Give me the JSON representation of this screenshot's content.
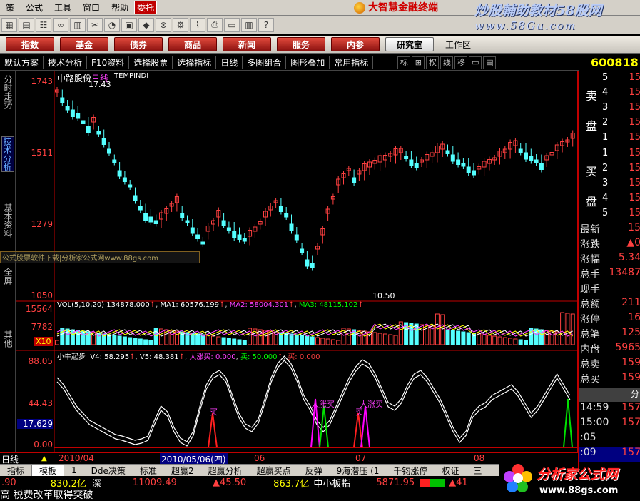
{
  "menu": {
    "items": [
      "策",
      "公式",
      "工具",
      "窗口",
      "帮助"
    ],
    "special": "委托",
    "banner": "大智慧金融终端"
  },
  "watermark_top": {
    "line1": "炒股輔助教材58股网",
    "line2": "www.58Gu.com"
  },
  "quickbar": {
    "buttons": [
      "指数",
      "基金",
      "债券",
      "商品",
      "新闻",
      "服务",
      "内参"
    ],
    "active": "研究室",
    "right": "工作区"
  },
  "funcbar": {
    "items": [
      "默认方案",
      "技术分析",
      "F10资料",
      "选择股票",
      "选择指标",
      "日线",
      "多图组合",
      "图形叠加",
      "常用指标"
    ],
    "toggles": [
      "标",
      "权",
      "线",
      "移"
    ],
    "stock_code": "600818"
  },
  "lefttabs": [
    "分时走势",
    "技术分析",
    "基本资料",
    "全屏",
    "其他"
  ],
  "kline": {
    "title_name": "中路股份",
    "title_period": "日线",
    "title_indicator": "TEMPINDI",
    "high_label": "17.43",
    "low_label": "10.50",
    "y_ticks": [
      "1743",
      "1511",
      "1279",
      "1050"
    ],
    "watermark": "公式股票软件下载|分析家公式网www.88gs.com"
  },
  "volume": {
    "header": "VOL(5,10,20)",
    "vol": "134878.000",
    "ma1_label": "MA1:",
    "ma1": "60576.199",
    "ma2_label": "MA2:",
    "ma2": "58004.301",
    "ma3_label": "MA3:",
    "ma3": "48115.102",
    "y_ticks": [
      "15564",
      "7782"
    ],
    "unit": "X10"
  },
  "indicator": {
    "name": "小牛起步",
    "v4_label": "V4:",
    "v4": "58.295",
    "v5_label": "V5:",
    "v5": "48.381",
    "big_buy_label": "大涨买:",
    "big_buy": "0.000",
    "sell_label": "卖:",
    "sell": "50.000",
    "buy_label": "买:",
    "buy": "0.000",
    "y_ticks": [
      "88.05",
      "44.43",
      "17.629",
      "0.00"
    ],
    "signals": [
      "买",
      "大涨买",
      "买",
      "大涨买"
    ]
  },
  "datebar": {
    "period": "日线",
    "months": [
      "2010/04",
      "06",
      "07",
      "08"
    ],
    "cursor_date": "2010/05/06",
    "cursor_day": "(四)"
  },
  "rightpanel": {
    "sell_label": [
      "卖",
      "盘"
    ],
    "buy_label": [
      "买",
      "盘"
    ],
    "sell_levels": [
      "5",
      "4",
      "3",
      "2",
      "1"
    ],
    "buy_levels": [
      "1",
      "2",
      "3",
      "4",
      "5"
    ],
    "sell_prices": [
      "15",
      "15",
      "15",
      "15",
      "15"
    ],
    "buy_prices": [
      "15",
      "15",
      "15",
      "15",
      "15"
    ],
    "stats": [
      {
        "k": "最新",
        "v": "15"
      },
      {
        "k": "涨跌",
        "v": "▲0"
      },
      {
        "k": "涨幅",
        "v": "5.34"
      },
      {
        "k": "总手",
        "v": "13487"
      },
      {
        "k": "现手",
        "v": ""
      },
      {
        "k": "总额",
        "v": "211"
      },
      {
        "k": "涨停",
        "v": "16"
      },
      {
        "k": "总笔",
        "v": "125"
      },
      {
        "k": "内盘",
        "v": "5965"
      },
      {
        "k": "总卖",
        "v": "159"
      },
      {
        "k": "总买",
        "v": "159"
      }
    ],
    "fen": "分",
    "ticks": [
      {
        "t": "14:59",
        "p": "157"
      },
      {
        "t": "15:00",
        "p": "157"
      },
      {
        "t": ":05",
        "p": ""
      },
      {
        "t": ":09",
        "p": "157"
      }
    ]
  },
  "tabbar": [
    "指标",
    "模板",
    "1",
    "Dde决策",
    "标准",
    "超赢2",
    "超赢分析",
    "超赢买点",
    "反弹",
    "9海潜压 (1",
    "千钧涨停",
    "权证",
    "三"
  ],
  "statusbar": {
    "v1": ".90",
    "v2": "830.2亿",
    "v3": "深",
    "v4": "11009.49",
    "v5": "▲45.50",
    "v6": "863.7亿",
    "v7": "中小板指",
    "v8": "5871.95",
    "v9": "▲41"
  },
  "ticker": "高 税费改革取得突破",
  "watermark_bottom": {
    "line1": "分析家公式网",
    "line2": "www.88gs.com"
  },
  "colors": {
    "up": "#ff4040",
    "down": "#54ffff",
    "axis": "#c00000",
    "ma_white": "#ffffff",
    "ma_yellow": "#ffff00",
    "ma_pink": "#ff40ff"
  }
}
